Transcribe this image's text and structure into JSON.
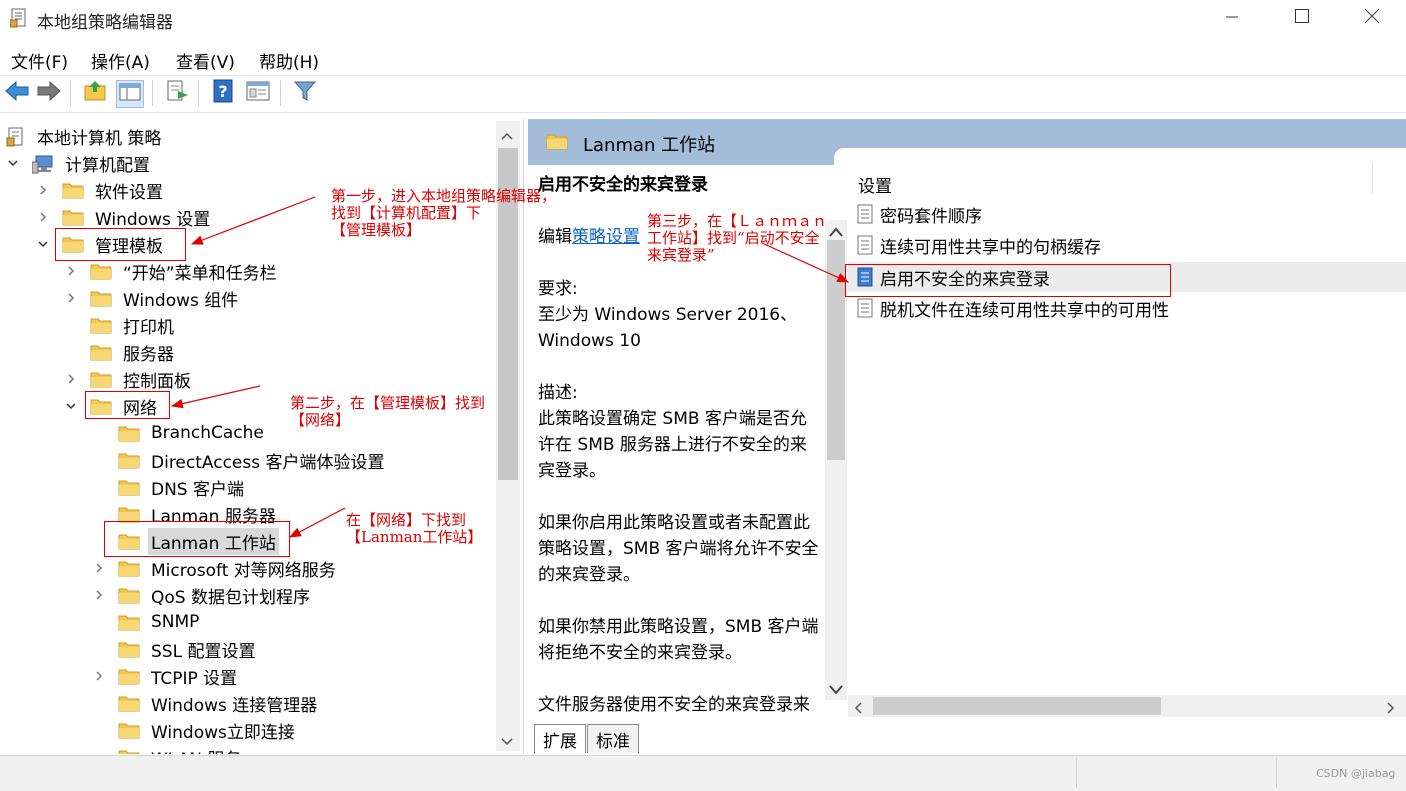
{
  "window": {
    "title": "本地组策略编辑器",
    "controls": {
      "minimize": "minimize-icon",
      "maximize": "maximize-icon",
      "close": "close-icon"
    }
  },
  "menu": [
    "文件(F)",
    "操作(A)",
    "查看(V)",
    "帮助(H)"
  ],
  "toolbar": [
    "back-arrow-icon",
    "forward-arrow-icon",
    "up-folder-icon",
    "show-tree-icon",
    "export-list-icon",
    "help-icon",
    "properties-icon",
    "filter-icon"
  ],
  "tree": {
    "root": "本地计算机 策略",
    "computer_config": "计算机配置",
    "software_settings": "软件设置",
    "windows_settings": "Windows 设置",
    "admin_templates": "管理模板",
    "start_menu": "“开始”菜单和任务栏",
    "windows_components": "Windows 组件",
    "printers": "打印机",
    "server": "服务器",
    "control_panel": "控制面板",
    "network": "网络",
    "branchcache": "BranchCache",
    "directaccess": "DirectAccess 客户端体验设置",
    "dns_client": "DNS 客户端",
    "lanman_server": "Lanman 服务器",
    "lanman_workstation": "Lanman 工作站",
    "microsoft_p2p": "Microsoft 对等网络服务",
    "qos": "QoS 数据包计划程序",
    "snmp": "SNMP",
    "ssl": "SSL 配置设置",
    "tcpip": "TCPIP 设置",
    "windows_connection_manager": "Windows 连接管理器",
    "windows_instant_connect": "Windows立即连接",
    "wlan_partial": "WLAN 服务"
  },
  "right": {
    "header_title": "Lanman 工作站",
    "desc_title": "启用不安全的来宾登录",
    "edit_prefix": "编辑",
    "edit_link": "策略设置",
    "requirements_label": "要求:",
    "requirements_text": "至少为 Windows Server 2016、Windows 10",
    "description_label": "描述:",
    "desc_p1": "此策略设置确定 SMB 客户端是否允许在 SMB 服务器上进行不安全的来宾登录。",
    "desc_p2": "如果你启用此策略设置或者未配置此策略设置，SMB 客户端将允许不安全的来宾登录。",
    "desc_p3": "如果你禁用此策略设置，SMB 客户端将拒绝不安全的来宾登录。",
    "desc_p4": "文件服务器使用不安全的来宾登录来允许对共享文件夹进行未经身份",
    "list_header": "设置",
    "list_items": [
      "密码套件顺序",
      "连续可用性共享中的句柄缓存",
      "启用不安全的来宾登录",
      "脱机文件在连续可用性共享中的可用性"
    ],
    "tab_extended": "扩展",
    "tab_standard": "标准"
  },
  "annotations": {
    "step1_line1": "第一步，进入本地组策略编辑器，",
    "step1_line2": "找到【计算机配置】下",
    "step1_line3": "【管理模板】",
    "step2_line1": "第二步，在【管理模板】找到",
    "step2_line2": "【网络】",
    "step3_line1": "第三步，在【Ｌａｎｍａｎ",
    "step3_line2": "工作站】找到“启动不安全",
    "step3_line3": "来宾登录”",
    "step4_line1": "在【网络】下找到",
    "step4_line2": "【Lanman工作站】",
    "color": "#e00000"
  },
  "watermark": "CSDN @jiabag",
  "colors": {
    "header_bg": "#a3bcd8",
    "folder": "#f2c94c",
    "link": "#0b62c7"
  }
}
